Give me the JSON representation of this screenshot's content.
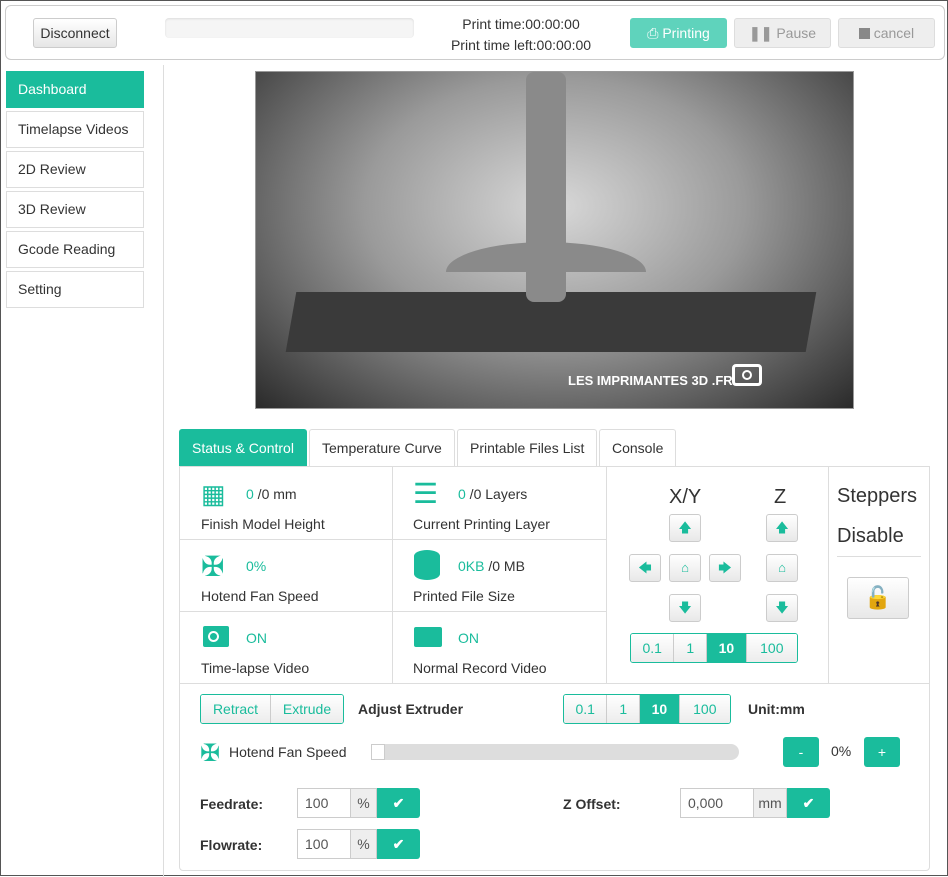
{
  "topbar": {
    "disconnect": "Disconnect",
    "print_time_label": "Print time:",
    "print_time": "00:00:00",
    "print_time_left_label": "Print time left:",
    "print_time_left": "00:00:00",
    "printing": "Printing",
    "pause": "Pause",
    "cancel": "cancel",
    "progress": 0
  },
  "sidebar": {
    "items": [
      {
        "label": "Dashboard"
      },
      {
        "label": "Timelapse Videos"
      },
      {
        "label": "2D Review"
      },
      {
        "label": "3D Review"
      },
      {
        "label": "Gcode Reading"
      },
      {
        "label": "Setting"
      }
    ]
  },
  "camera": {
    "watermark": "LES IMPRIMANTES 3D .FR"
  },
  "tabs": [
    {
      "label": "Status & Control"
    },
    {
      "label": "Temperature Curve"
    },
    {
      "label": "Printable Files List"
    },
    {
      "label": "Console"
    }
  ],
  "status": {
    "height": {
      "value": "0",
      "total": " /0 mm",
      "label": "Finish Model Height"
    },
    "layer": {
      "value": "0",
      "total": " /0 Layers",
      "label": "Current Printing Layer"
    },
    "fan": {
      "value": "0%",
      "label": "Hotend Fan Speed"
    },
    "filesize": {
      "value": "0KB",
      "total": " /0 MB",
      "label": "Printed File Size"
    },
    "timelapse": {
      "value": "ON",
      "label": "Time-lapse Video"
    },
    "record": {
      "value": "ON",
      "label": "Normal Record Video"
    }
  },
  "jog": {
    "xy": "X/Y",
    "z": "Z",
    "steps": [
      "0.1",
      "1",
      "10",
      "100"
    ],
    "selected": "10"
  },
  "steppers": {
    "line1": "Steppers",
    "line2": "Disable"
  },
  "extruder": {
    "retract": "Retract",
    "extrude": "Extrude",
    "label": "Adjust Extruder",
    "steps": [
      "0.1",
      "1",
      "10",
      "100"
    ],
    "selected": "10",
    "unit": "Unit:mm"
  },
  "fan_control": {
    "label": "Hotend Fan Speed",
    "value": "0%",
    "minus": "-",
    "plus": "+",
    "level": 0
  },
  "feedrate": {
    "label": "Feedrate:",
    "value": "100",
    "unit": "%"
  },
  "flowrate": {
    "label": "Flowrate:",
    "value": "100",
    "unit": "%"
  },
  "zoffset": {
    "label": "Z Offset:",
    "value": "0,000",
    "unit": "mm"
  },
  "colors": {
    "accent": "#1abc9c"
  }
}
